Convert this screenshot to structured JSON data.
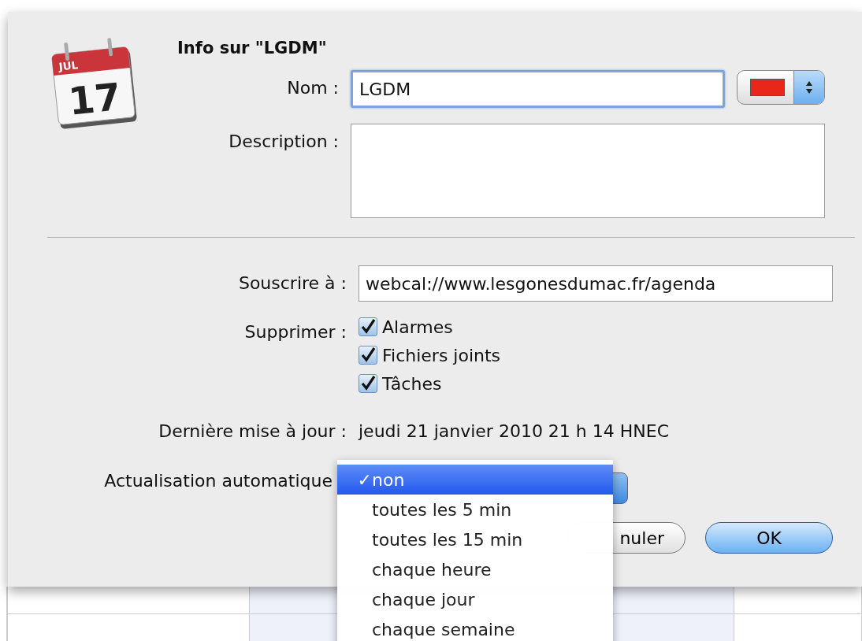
{
  "dialog": {
    "title": "Info sur \"LGDM\"",
    "icon": {
      "month": "JUL",
      "day": "17"
    },
    "name": {
      "label": "Nom :",
      "value": "LGDM",
      "color": "#e8261c"
    },
    "description": {
      "label": "Description :"
    },
    "subscribe": {
      "label": "Souscrire à :",
      "value": "webcal://www.lesgonesdumac.fr/agenda"
    },
    "remove": {
      "label": "Supprimer :",
      "options": [
        {
          "label": "Alarmes",
          "checked": true
        },
        {
          "label": "Fichiers joints",
          "checked": true
        },
        {
          "label": "Tâches",
          "checked": true
        }
      ]
    },
    "last_update": {
      "label": "Dernière mise à jour :",
      "value": "jeudi 21 janvier 2010 21 h 14 HNEC"
    },
    "auto_refresh": {
      "label": "Actualisation automatique",
      "menu": {
        "check_mark": "✓",
        "items": [
          {
            "label": "non",
            "selected": true
          },
          {
            "label": "toutes les 5 min",
            "selected": false
          },
          {
            "label": "toutes les 15 min",
            "selected": false
          },
          {
            "label": "chaque heure",
            "selected": false
          },
          {
            "label": "chaque jour",
            "selected": false
          },
          {
            "label": "chaque semaine",
            "selected": false
          }
        ]
      }
    },
    "buttons": [
      {
        "label": "nuler",
        "kind": "cancel"
      },
      {
        "label": "OK",
        "kind": "default"
      }
    ]
  }
}
